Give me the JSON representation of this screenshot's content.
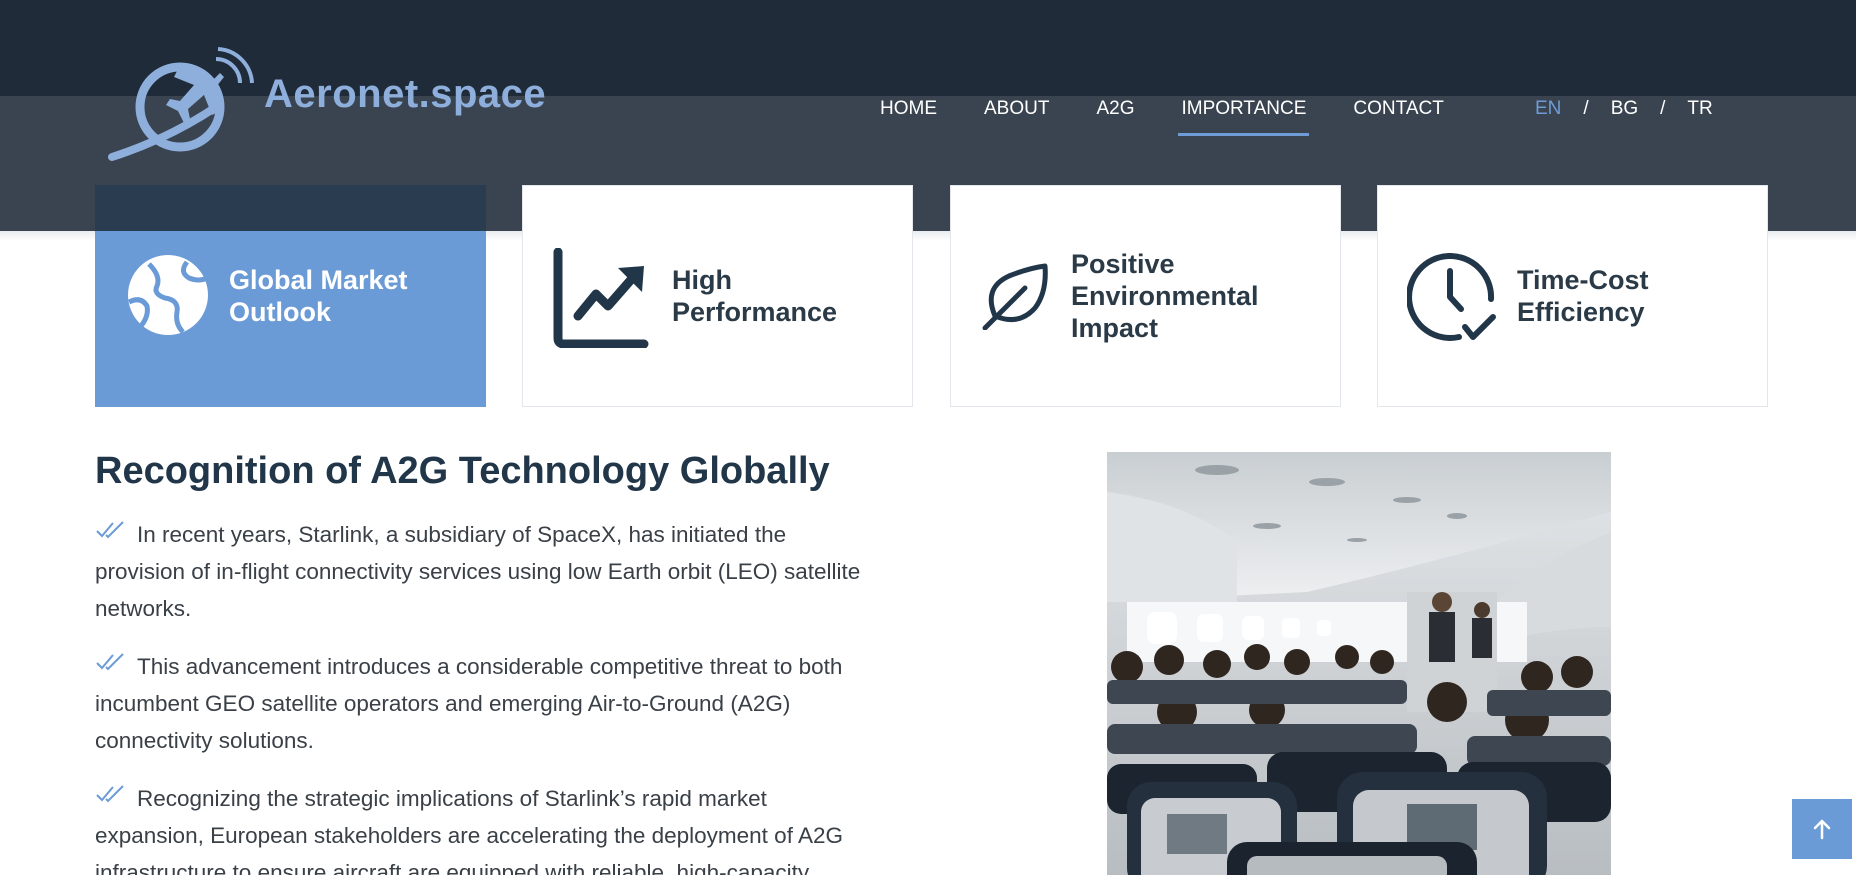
{
  "brand": {
    "name": "Aeronet.space",
    "logo_icon": "airplane-signal-icon",
    "color": "#8eaedc"
  },
  "nav": {
    "items": [
      {
        "label": "HOME"
      },
      {
        "label": "ABOUT"
      },
      {
        "label": "A2G"
      },
      {
        "label": "IMPORTANCE",
        "active": true
      },
      {
        "label": "CONTACT"
      }
    ],
    "languages": {
      "current": "EN",
      "others": [
        "BG",
        "TR"
      ],
      "separator": "/"
    }
  },
  "features": [
    {
      "label_line1": "Global Market",
      "label_line2": "Outlook",
      "icon": "globe-icon",
      "active": true
    },
    {
      "label_line1": "High",
      "label_line2": "Performance",
      "icon": "trend-chart-icon"
    },
    {
      "label_line1": "Positive",
      "label_line2": "Environmental",
      "label_line3": "Impact",
      "icon": "leaf-icon"
    },
    {
      "label_line1": "Time-Cost",
      "label_line2": "Efficiency",
      "icon": "clock-check-icon"
    }
  ],
  "section": {
    "title": "Recognition of A2G Technology Globally",
    "paragraphs": [
      {
        "line1": "In recent years, Starlink, a subsidiary of SpaceX, has initiated the",
        "line2": "provision of in-flight connectivity services using low Earth orbit (LEO) satellite",
        "line3": "networks."
      },
      {
        "line1": "This advancement introduces a considerable competitive threat to both",
        "line2": "incumbent GEO satellite operators and emerging Air-to-Ground (A2G)",
        "line3": "connectivity solutions."
      },
      {
        "line1": "Recognizing the strategic implications of Starlink’s rapid market",
        "line2": "expansion, European stakeholders are accelerating the deployment of A2G",
        "line3": "infrastructure to ensure aircraft are equipped with reliable, high-capacity"
      }
    ],
    "bullet_icon": "double-check-icon",
    "image": "aircraft-cabin-photo"
  },
  "scroll_top": {
    "icon": "arrow-up-icon"
  },
  "colors": {
    "accent": "#6b9bd6",
    "header": "#3a4450",
    "topbar": "#1f2b38",
    "heading": "#22364a"
  }
}
